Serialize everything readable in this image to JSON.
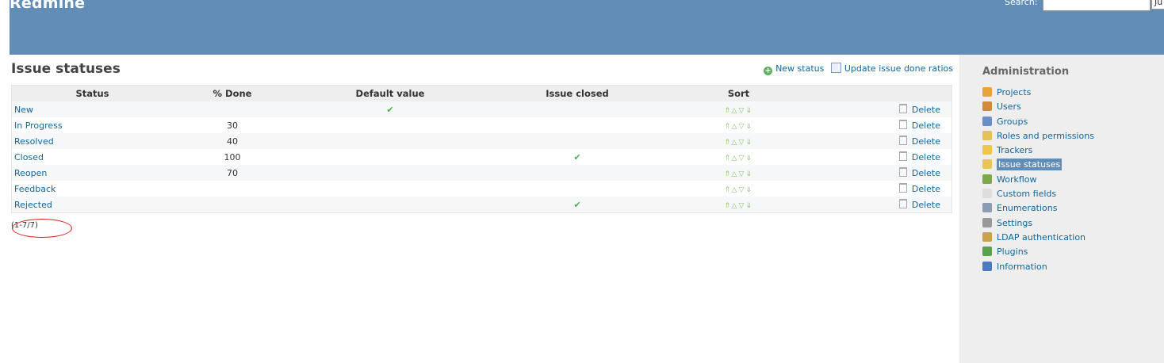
{
  "header": {
    "app_title": "Redmine",
    "search_label": "Search:",
    "search_value": "",
    "jump_label": "Ju"
  },
  "main": {
    "page_title": "Issue statuses",
    "actions": {
      "new_status": "New status",
      "update_done_ratios": "Update issue done ratios"
    },
    "columns": {
      "status": "Status",
      "done": "% Done",
      "default_value": "Default value",
      "issue_closed": "Issue closed",
      "sort": "Sort"
    },
    "rows": [
      {
        "name": "New",
        "done": "",
        "is_default": true,
        "is_closed": false,
        "delete": "Delete"
      },
      {
        "name": "In Progress",
        "done": "30",
        "is_default": false,
        "is_closed": false,
        "delete": "Delete"
      },
      {
        "name": "Resolved",
        "done": "40",
        "is_default": false,
        "is_closed": false,
        "delete": "Delete"
      },
      {
        "name": "Closed",
        "done": "100",
        "is_default": false,
        "is_closed": true,
        "delete": "Delete"
      },
      {
        "name": "Reopen",
        "done": "70",
        "is_default": false,
        "is_closed": false,
        "delete": "Delete"
      },
      {
        "name": "Feedback",
        "done": "",
        "is_default": false,
        "is_closed": false,
        "delete": "Delete"
      },
      {
        "name": "Rejected",
        "done": "",
        "is_default": false,
        "is_closed": true,
        "delete": "Delete"
      }
    ],
    "check_mark": "✔",
    "pagination": "(1-7/7)"
  },
  "sidebar": {
    "title": "Administration",
    "items": [
      {
        "label": "Projects",
        "icon": "projects-icon",
        "color": "#e8a33d",
        "selected": false
      },
      {
        "label": "Users",
        "icon": "user-icon",
        "color": "#d08a3a",
        "selected": false
      },
      {
        "label": "Groups",
        "icon": "group-icon",
        "color": "#6a8fc7",
        "selected": false
      },
      {
        "label": "Roles and permissions",
        "icon": "key-icon",
        "color": "#e3c25b",
        "selected": false
      },
      {
        "label": "Trackers",
        "icon": "ticket-icon",
        "color": "#f0c34e",
        "selected": false
      },
      {
        "label": "Issue statuses",
        "icon": "status-icon",
        "color": "#e9c558",
        "selected": true
      },
      {
        "label": "Workflow",
        "icon": "workflow-icon",
        "color": "#7aa84a",
        "selected": false
      },
      {
        "label": "Custom fields",
        "icon": "custom-fields-icon",
        "color": "#dddddd",
        "selected": false
      },
      {
        "label": "Enumerations",
        "icon": "list-icon",
        "color": "#8a9bb3",
        "selected": false
      },
      {
        "label": "Settings",
        "icon": "gear-icon",
        "color": "#999999",
        "selected": false
      },
      {
        "label": "LDAP authentication",
        "icon": "ldap-icon",
        "color": "#c9a24a",
        "selected": false
      },
      {
        "label": "Plugins",
        "icon": "puzzle-icon",
        "color": "#5aa34a",
        "selected": false
      },
      {
        "label": "Information",
        "icon": "info-icon",
        "color": "#4d7bc2",
        "selected": false
      }
    ]
  },
  "annotation": {
    "color": "#dd2222"
  }
}
